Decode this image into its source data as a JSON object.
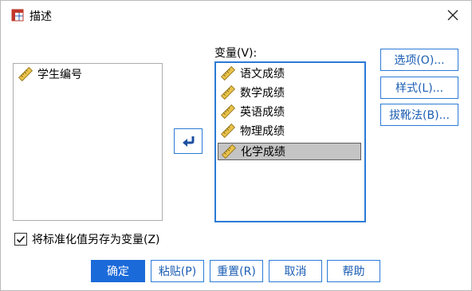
{
  "window": {
    "title": "描述",
    "icon": "spss-table-icon",
    "close_icon": "close-icon"
  },
  "source": {
    "items": [
      {
        "label": "学生编号",
        "icon": "ruler-scale-icon"
      }
    ]
  },
  "target": {
    "label": "变量(V):",
    "items": [
      {
        "label": "语文成绩",
        "icon": "ruler-scale-icon"
      },
      {
        "label": "数学成绩",
        "icon": "ruler-scale-icon"
      },
      {
        "label": "英语成绩",
        "icon": "ruler-scale-icon"
      },
      {
        "label": "物理成绩",
        "icon": "ruler-scale-icon"
      },
      {
        "label": "化学成绩",
        "icon": "ruler-scale-icon",
        "selected": true
      }
    ]
  },
  "move_button": {
    "icon": "arrow-back-left-icon"
  },
  "side_buttons": {
    "options": "选项(O)...",
    "style": "样式(L)...",
    "bootstrap": "拔靴法(B)..."
  },
  "checkbox": {
    "label": "将标准化值另存为变量(Z)",
    "checked": true
  },
  "footer": {
    "ok": "确定",
    "paste": "粘贴(P)",
    "reset": "重置(R)",
    "cancel": "取消",
    "help": "帮助"
  },
  "colors": {
    "accent": "#2b7bd6",
    "primary": "#1b6ad9",
    "selected_bg": "#c4c4c4"
  }
}
